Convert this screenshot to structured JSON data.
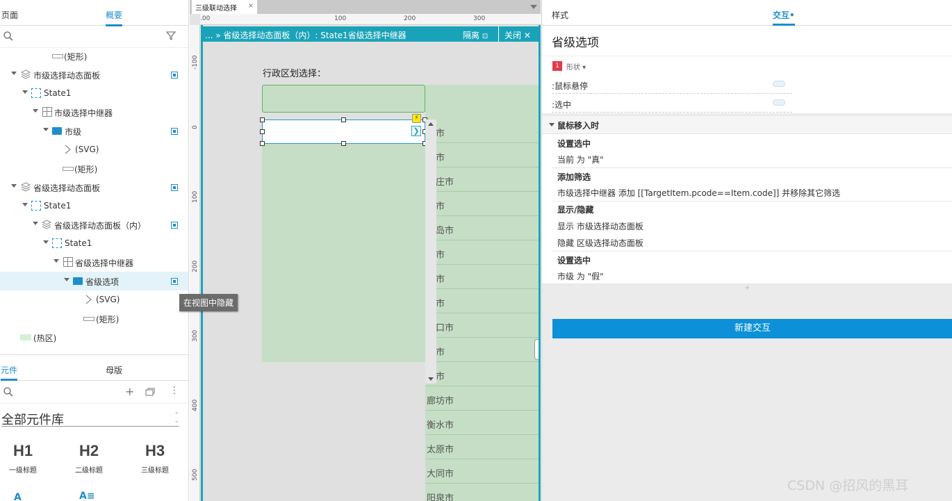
{
  "left_panel": {
    "tabs": [
      "页面",
      "概要"
    ],
    "outline": [
      {
        "label": "(矩形)"
      },
      {
        "label": "市级选择动态面板"
      },
      {
        "label": "State1"
      },
      {
        "label": "市级选择中继器"
      },
      {
        "label": "市级"
      },
      {
        "label": "(SVG)"
      },
      {
        "label": "(矩形)"
      },
      {
        "label": "省级选择动态面板"
      },
      {
        "label": "State1"
      },
      {
        "label": "省级选择动态面板（内）"
      },
      {
        "label": "State1"
      },
      {
        "label": "省级选择中继器"
      },
      {
        "label": "省级选项"
      },
      {
        "label": "(SVG)"
      },
      {
        "label": "(矩形)"
      },
      {
        "label": "(热区)"
      }
    ],
    "tooltip": "在视图中隐藏",
    "lib_tabs": [
      "元件",
      "母版"
    ],
    "library_title": "全部元件库",
    "library_items": [
      {
        "big": "H1",
        "small": "一级标题"
      },
      {
        "big": "H2",
        "small": "二级标题"
      },
      {
        "big": "H3",
        "small": "三级标题"
      }
    ]
  },
  "center": {
    "page_tab": "三级联动选择",
    "ruler_top": [
      ".00",
      "100",
      "200",
      "300"
    ],
    "ruler_left": [
      "-100",
      "0",
      "100",
      "200",
      "300",
      "400",
      "500"
    ],
    "frame_path": "... » 省级选择动态面板（内）: State1省级选择中继器",
    "isolate_label": "隔离",
    "close_label": "关闭",
    "canvas_label": "行政区划选择：",
    "cities": [
      "京市",
      "津市",
      "家庄市",
      "山市",
      "皇岛市",
      "郸市",
      "台市",
      "定市",
      "家口市",
      "德市",
      "州市",
      "廊坊市",
      "衡水市",
      "太原市",
      "大同市",
      "阳泉市"
    ]
  },
  "right_panel": {
    "tabs": [
      "样式",
      "交互•"
    ],
    "title": "省级选项",
    "shape_badge": "1",
    "shape_label": "形状 ▾",
    "states": [
      ":鼠标悬停",
      ":选中"
    ],
    "event": "鼠标移入时",
    "actions": [
      {
        "title": "设置选中",
        "lines": [
          "当前 为 \"真\""
        ]
      },
      {
        "title": "添加筛选",
        "lines": [
          "市级选择中继器 添加 [[TargetItem.pcode==Item.code]] 并移除其它筛选"
        ]
      },
      {
        "title": "显示/隐藏",
        "lines": [
          "显示 市级选择动态面板",
          "隐藏 区级选择动态面板"
        ]
      },
      {
        "title": "设置选中",
        "lines": [
          "市级 为 \"假\""
        ]
      }
    ],
    "plus": "+",
    "new_button": "新建交互"
  },
  "watermark": "CSDN @招风的黑耳"
}
